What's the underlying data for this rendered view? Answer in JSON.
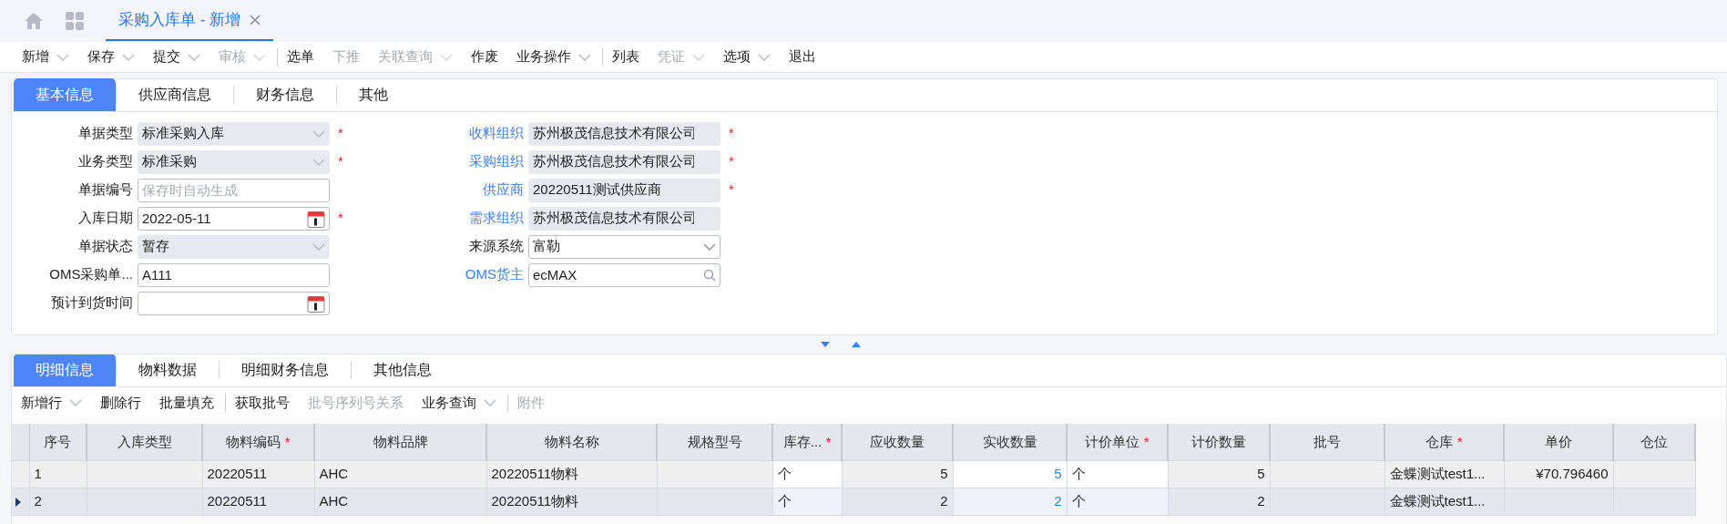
{
  "top_tabs": [
    {
      "label": "采购入库单 - 新增",
      "selected": true
    }
  ],
  "toolbar": [
    {
      "label": "新增",
      "dropdown": true,
      "disabled": false,
      "separator_before": false
    },
    {
      "label": "保存",
      "dropdown": true,
      "disabled": false,
      "separator_before": false
    },
    {
      "label": "提交",
      "dropdown": true,
      "disabled": false,
      "separator_before": false
    },
    {
      "label": "审核",
      "dropdown": true,
      "disabled": true,
      "separator_before": false
    },
    {
      "label": "选单",
      "dropdown": false,
      "disabled": false,
      "separator_before": true
    },
    {
      "label": "下推",
      "dropdown": false,
      "disabled": true,
      "separator_before": false
    },
    {
      "label": "关联查询",
      "dropdown": true,
      "disabled": true,
      "separator_before": false
    },
    {
      "label": "作废",
      "dropdown": false,
      "disabled": false,
      "separator_before": false
    },
    {
      "label": "业务操作",
      "dropdown": true,
      "disabled": false,
      "separator_before": false
    },
    {
      "label": "列表",
      "dropdown": false,
      "disabled": false,
      "separator_before": true
    },
    {
      "label": "凭证",
      "dropdown": true,
      "disabled": true,
      "separator_before": false
    },
    {
      "label": "选项",
      "dropdown": true,
      "disabled": false,
      "separator_before": false
    },
    {
      "label": "退出",
      "dropdown": false,
      "disabled": false,
      "separator_before": false
    }
  ],
  "form_tabs": [
    {
      "label": "基本信息",
      "selected": true
    },
    {
      "label": "供应商信息",
      "selected": false
    },
    {
      "label": "财务信息",
      "selected": false
    },
    {
      "label": "其他",
      "selected": false
    }
  ],
  "form_left": [
    {
      "label": "单据类型",
      "kind": "select",
      "value": "标准采购入库",
      "readonly": true,
      "required_mark": "*",
      "link": false
    },
    {
      "label": "业务类型",
      "kind": "select",
      "value": "标准采购",
      "readonly": true,
      "required_mark": "*",
      "link": false
    },
    {
      "label": "单据编号",
      "kind": "text",
      "placeholder": "保存时自动生成",
      "readonly": false,
      "link": false
    },
    {
      "label": "入库日期",
      "kind": "date",
      "value": "2022-05-11",
      "readonly": false,
      "required_mark": "*",
      "link": false
    },
    {
      "label": "单据状态",
      "kind": "select",
      "value": "暂存",
      "readonly": true,
      "link": false
    },
    {
      "label": "OMS采购单...",
      "kind": "text",
      "value": "A111",
      "readonly": false,
      "link": false
    },
    {
      "label": "预计到货时间",
      "kind": "date",
      "readonly": false,
      "link": false
    }
  ],
  "form_right": [
    {
      "label": "收料组织",
      "kind": "text",
      "value": "苏州极茂信息技术有限公司",
      "readonly": true,
      "required_mark": "*",
      "link": true
    },
    {
      "label": "采购组织",
      "kind": "text",
      "value": "苏州极茂信息技术有限公司",
      "readonly": true,
      "required_mark": "*",
      "link": true
    },
    {
      "label": "供应商",
      "kind": "text",
      "value": "20220511测试供应商",
      "readonly": true,
      "required_mark": "*",
      "link": true
    },
    {
      "label": "需求组织",
      "kind": "text",
      "value": "苏州极茂信息技术有限公司",
      "readonly": true,
      "link": true
    },
    {
      "label": "来源系统",
      "kind": "select",
      "value": "富勒",
      "readonly": false,
      "link": false
    },
    {
      "label": "OMS货主",
      "kind": "lookup",
      "value": "ecMAX",
      "readonly": false,
      "link": true
    }
  ],
  "detail_tabs": [
    {
      "label": "明细信息",
      "selected": true
    },
    {
      "label": "物料数据",
      "selected": false
    },
    {
      "label": "明细财务信息",
      "selected": false
    },
    {
      "label": "其他信息",
      "selected": false
    }
  ],
  "detail_toolbar": [
    {
      "label": "新增行",
      "dropdown": true,
      "disabled": false,
      "separator_before": false
    },
    {
      "label": "删除行",
      "dropdown": false,
      "disabled": false,
      "separator_before": false
    },
    {
      "label": "批量填充",
      "dropdown": false,
      "disabled": false,
      "separator_before": false
    },
    {
      "label": "获取批号",
      "dropdown": false,
      "disabled": false,
      "separator_before": true
    },
    {
      "label": "批号序列号关系",
      "dropdown": false,
      "disabled": true,
      "separator_before": false
    },
    {
      "label": "业务查询",
      "dropdown": true,
      "disabled": false,
      "separator_before": false
    },
    {
      "label": "附件",
      "dropdown": false,
      "disabled": true,
      "separator_before": true
    }
  ],
  "table": {
    "columns": [
      {
        "label": "序号",
        "kind": "text"
      },
      {
        "label": "入库类型",
        "kind": "text"
      },
      {
        "label": "物料编码",
        "kind": "text",
        "required_mark": "*"
      },
      {
        "label": "物料品牌",
        "kind": "text"
      },
      {
        "label": "物料名称",
        "kind": "text"
      },
      {
        "label": "规格型号",
        "kind": "text"
      },
      {
        "label": "库存...",
        "kind": "input",
        "required_mark": "*"
      },
      {
        "label": "应收数量",
        "kind": "number"
      },
      {
        "label": "实收数量",
        "kind": "input-number"
      },
      {
        "label": "计价单位",
        "kind": "input",
        "required_mark": "*"
      },
      {
        "label": "计价数量",
        "kind": "number"
      },
      {
        "label": "批号",
        "kind": "text"
      },
      {
        "label": "仓库",
        "kind": "text",
        "required_mark": "*"
      },
      {
        "label": "单价",
        "kind": "number"
      },
      {
        "label": "仓位",
        "kind": "text"
      }
    ],
    "rows": [
      {
        "selected": false,
        "cells": [
          "1",
          null,
          "20220511",
          "AHC",
          "20220511物料",
          null,
          "个",
          "5",
          "5",
          "个",
          "5",
          null,
          "金蝶测试test1...",
          "¥70.796460",
          null
        ]
      },
      {
        "selected": true,
        "cells": [
          "2",
          null,
          "20220511",
          "AHC",
          "20220511物料",
          null,
          "个",
          "2",
          "2",
          "个",
          "2",
          null,
          "金蝶测试test1...",
          null,
          null
        ]
      }
    ]
  }
}
